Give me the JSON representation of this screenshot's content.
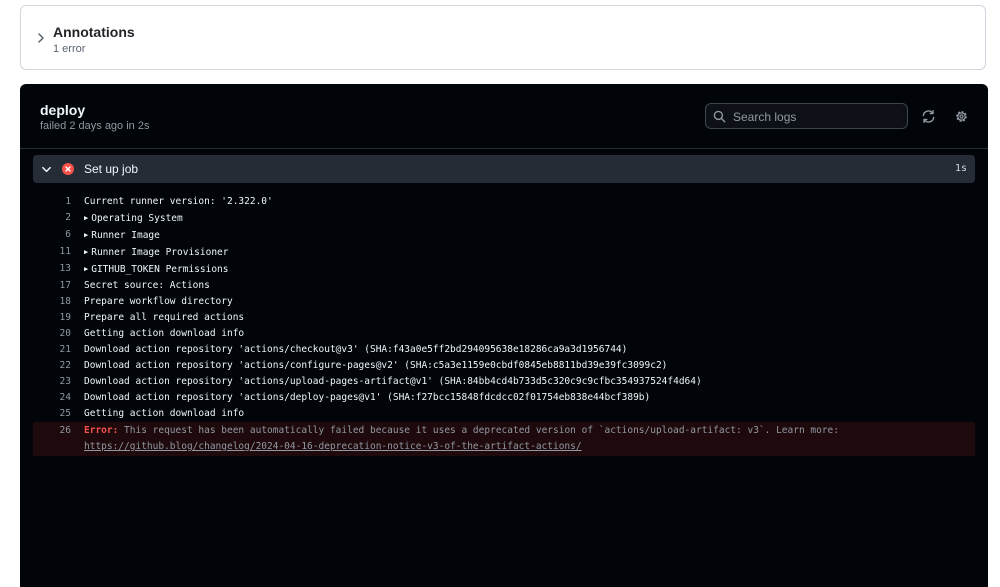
{
  "annotations": {
    "title": "Annotations",
    "summary": "1 error"
  },
  "job": {
    "name": "deploy",
    "status_text": "failed 2 days ago in 2s"
  },
  "search": {
    "placeholder": "Search logs"
  },
  "step": {
    "name": "Set up job",
    "duration": "1s",
    "status": "failed"
  },
  "log_lines": [
    {
      "num": "1",
      "text": "Current runner version: '2.322.0'",
      "expandable": false
    },
    {
      "num": "2",
      "text": "Operating System",
      "expandable": true
    },
    {
      "num": "6",
      "text": "Runner Image",
      "expandable": true
    },
    {
      "num": "11",
      "text": "Runner Image Provisioner",
      "expandable": true
    },
    {
      "num": "13",
      "text": "GITHUB_TOKEN Permissions",
      "expandable": true
    },
    {
      "num": "17",
      "text": "Secret source: Actions",
      "expandable": false
    },
    {
      "num": "18",
      "text": "Prepare workflow directory",
      "expandable": false
    },
    {
      "num": "19",
      "text": "Prepare all required actions",
      "expandable": false
    },
    {
      "num": "20",
      "text": "Getting action download info",
      "expandable": false
    },
    {
      "num": "21",
      "text": "Download action repository 'actions/checkout@v3' (SHA:f43a0e5ff2bd294095638e18286ca9a3d1956744)",
      "expandable": false
    },
    {
      "num": "22",
      "text": "Download action repository 'actions/configure-pages@v2' (SHA:c5a3e1159e0cbdf0845eb8811bd39e39fc3099c2)",
      "expandable": false
    },
    {
      "num": "23",
      "text": "Download action repository 'actions/upload-pages-artifact@v1' (SHA:84bb4cd4b733d5c320c9c9cfbc354937524f4d64)",
      "expandable": false
    },
    {
      "num": "24",
      "text": "Download action repository 'actions/deploy-pages@v1' (SHA:f27bcc15848fdcdcc02f01754eb838e44bcf389b)",
      "expandable": false
    },
    {
      "num": "25",
      "text": "Getting action download info",
      "expandable": false
    }
  ],
  "error_line": {
    "num": "26",
    "label": "Error:",
    "message": " This request has been automatically failed because it uses a deprecated version of `actions/upload-artifact: v3`. Learn more: ",
    "link": "https://github.blog/changelog/2024-04-16-deprecation-notice-v3-of-the-artifact-actions/"
  },
  "colors": {
    "error": "#f85149",
    "panel_bg": "#010409",
    "step_bg": "#262c36"
  }
}
